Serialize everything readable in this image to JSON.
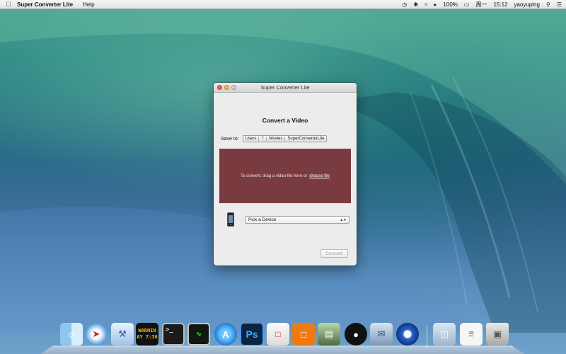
{
  "menubar": {
    "apple_icon": "apple-icon",
    "app_name": "Super Converter Lite",
    "menus": [
      "Help"
    ],
    "status": {
      "battery": "100%",
      "day": "周一",
      "time": "15:12",
      "user": "yaoyuping"
    }
  },
  "window": {
    "title": "Super Converter Lite",
    "heading": "Convert a Video",
    "save_to_label": "Save to:",
    "path": [
      "Users",
      "E",
      "Movies",
      "SuperConverterLite"
    ],
    "drop_text": "To convert, drag a video file here or",
    "choose_file": "choose file",
    "device_select": "Pick a Device",
    "convert_button": "Convert!"
  },
  "dock": {
    "items": [
      "finder-icon",
      "safari-icon",
      "xcode-icon",
      "console-icon",
      "terminal-icon",
      "activity-monitor-icon",
      "app-store-icon",
      "photoshop-icon",
      "preview-icon",
      "ibooks-icon",
      "archive-utility-icon",
      "qq-icon",
      "mail-icon",
      "system-preferences-icon",
      "downloads-folder-icon",
      "documents-stack-icon",
      "trash-icon"
    ],
    "console_text_1": "WARNIN",
    "console_text_2": "AY 7:36",
    "photoshop_label": "Ps"
  }
}
